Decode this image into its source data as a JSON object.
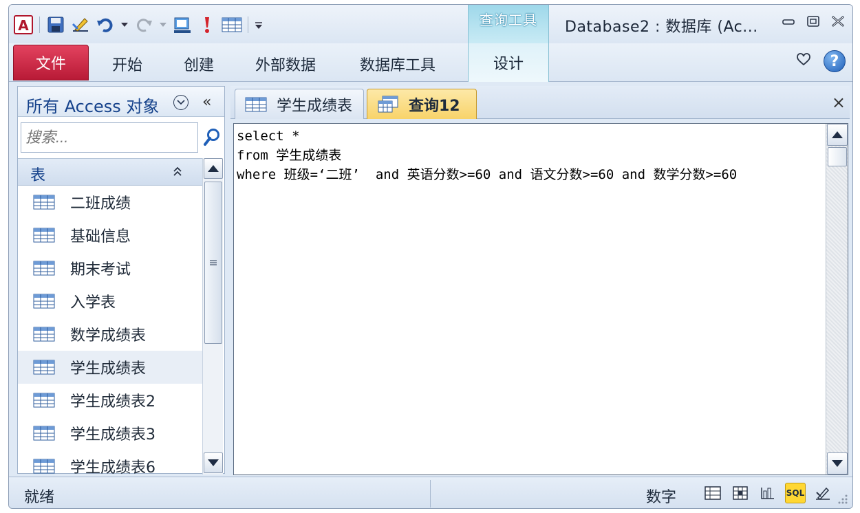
{
  "titlebar": {
    "context_group": "查询工具",
    "title": "Database2 : 数据库 (Ac..."
  },
  "ribbon": {
    "tabs": [
      "文件",
      "开始",
      "创建",
      "外部数据",
      "数据库工具"
    ],
    "context_tab": "设计"
  },
  "nav": {
    "title": "所有 Access 对象",
    "collapse": "«",
    "search_placeholder": "搜索...",
    "group": {
      "title": "表",
      "collapse": "⌃"
    },
    "items": [
      {
        "label": "二班成绩"
      },
      {
        "label": "基础信息"
      },
      {
        "label": "期末考试"
      },
      {
        "label": "入学表"
      },
      {
        "label": "数学成绩表"
      },
      {
        "label": "学生成绩表"
      },
      {
        "label": "学生成绩表2"
      },
      {
        "label": "学生成绩表3"
      },
      {
        "label": "学生成绩表6"
      }
    ],
    "selected_index": 5
  },
  "document": {
    "tabs": [
      {
        "label": "学生成绩表",
        "active": false
      },
      {
        "label": "查询12",
        "active": true
      }
    ],
    "close": "×",
    "sql_lines": [
      "select *",
      "from 学生成绩表",
      "where 班级=‘二班’  and 英语分数>=60 and 语文分数>=60 and 数学分数>=60"
    ]
  },
  "statusbar": {
    "status": "就绪",
    "numlock": "数字",
    "sql_view_label": "SQL"
  },
  "colors": {
    "file_tab": "#c8223e",
    "active_doc_tab": "#f8d36a",
    "context_tab": "#9ed8ea",
    "help": "#1f5fb8"
  }
}
